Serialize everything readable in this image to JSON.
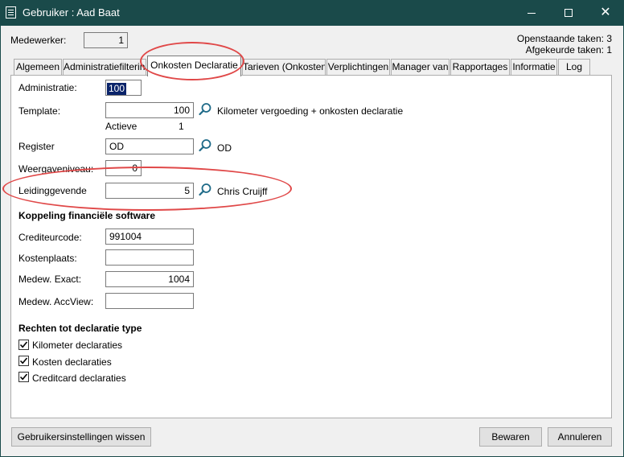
{
  "window": {
    "title": "Gebruiker : Aad Baat",
    "icon": "form-icon"
  },
  "header": {
    "medewerker_label": "Medewerker:",
    "medewerker_value": "1",
    "openstaande": "Openstaande taken: 3",
    "afgekeurde": "Afgekeurde taken: 1"
  },
  "tabs": [
    {
      "label": "Algemeen"
    },
    {
      "label": "Administratiefiltering"
    },
    {
      "label": "Onkosten Declaratie"
    },
    {
      "label": "Tarieven (Onkosten)"
    },
    {
      "label": "Verplichtingen"
    },
    {
      "label": "Manager van"
    },
    {
      "label": "Rapportages"
    },
    {
      "label": "Informatie"
    },
    {
      "label": "Log"
    }
  ],
  "form": {
    "administratie_label": "Administratie:",
    "administratie_value": "100",
    "template_label": "Template:",
    "template_value": "100",
    "template_desc": "Kilometer vergoeding + onkosten declaratie",
    "actieve_label": "Actieve",
    "actieve_value": "1",
    "register_label": "Register",
    "register_value": "OD",
    "register_desc": "OD",
    "weergave_label": "Weergaveniveau:",
    "weergave_value": "0",
    "leiding_label": "Leidinggevende",
    "leiding_value": "5",
    "leiding_desc": "Chris Cruijff"
  },
  "koppeling": {
    "title": "Koppeling financiële software",
    "crediteur_label": "Crediteurcode:",
    "crediteur_value": "991004",
    "kosten_label": "Kostenplaats:",
    "kosten_value": "",
    "exact_label": "Medew. Exact:",
    "exact_value": "1004",
    "accview_label": "Medew. AccView:",
    "accview_value": ""
  },
  "rechten": {
    "title": "Rechten tot declaratie type",
    "items": [
      {
        "label": "Kilometer declaraties",
        "checked": true
      },
      {
        "label": "Kosten declaraties",
        "checked": true
      },
      {
        "label": "Creditcard declaraties",
        "checked": true
      }
    ]
  },
  "buttons": {
    "reset": "Gebruikersinstellingen wissen",
    "save": "Bewaren",
    "cancel": "Annuleren"
  },
  "colors": {
    "titlebar": "#1a4a4a",
    "highlight": "#e04848",
    "selection": "#0a246a"
  }
}
